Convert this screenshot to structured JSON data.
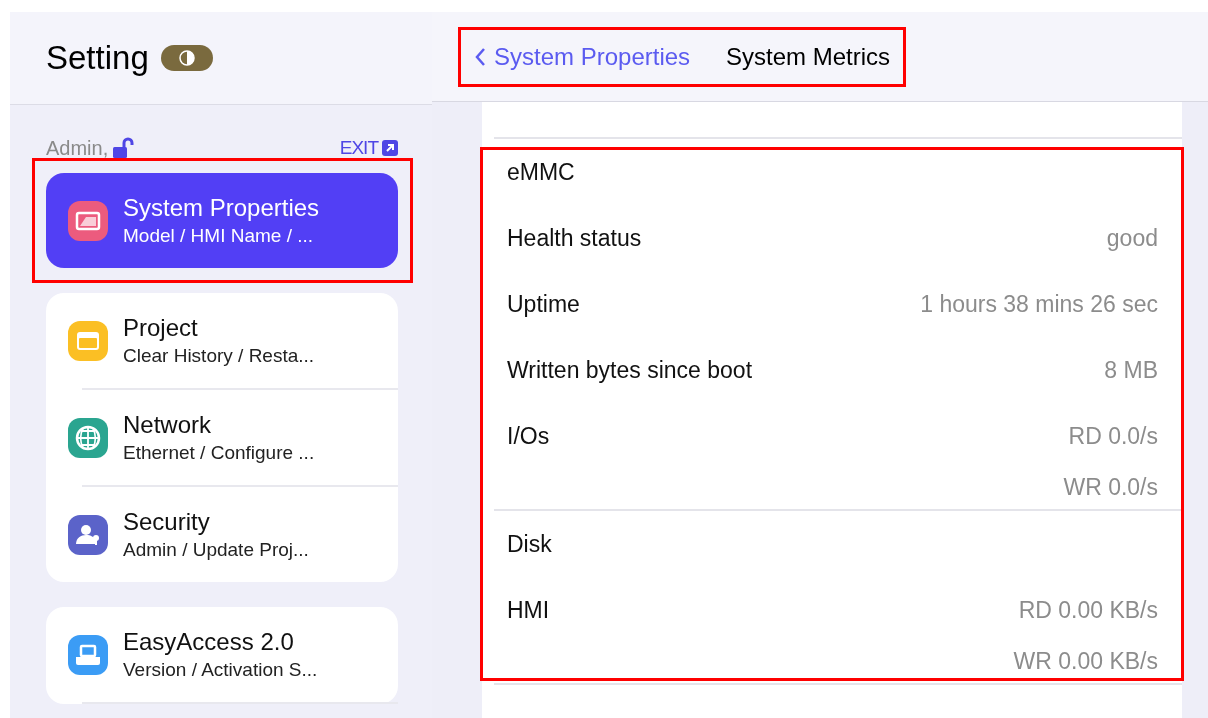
{
  "title": "Setting",
  "user": {
    "label": "Admin,",
    "locked": false
  },
  "exit": {
    "label": "EXIT"
  },
  "sidebar": {
    "groups": [
      {
        "items": [
          {
            "title": "System Properties",
            "subtitle": "Model / HMI Name / ...",
            "selected": true,
            "highlighted": true,
            "color": "#ec5b7e"
          }
        ]
      },
      {
        "items": [
          {
            "title": "Project",
            "subtitle": "Clear History / Resta...",
            "selected": false,
            "highlighted": false,
            "color": "#fbbf24"
          },
          {
            "title": "Network",
            "subtitle": "Ethernet / Configure ...",
            "selected": false,
            "highlighted": false,
            "color": "#2aa590"
          },
          {
            "title": "Security",
            "subtitle": "Admin / Update Proj...",
            "selected": false,
            "highlighted": false,
            "color": "#5b63c9"
          }
        ]
      },
      {
        "items": [
          {
            "title": "EasyAccess 2.0",
            "subtitle": "Version / Activation S...",
            "selected": false,
            "highlighted": false,
            "color": "#3b9cf5"
          }
        ]
      }
    ]
  },
  "breadcrumb": {
    "back": "System Properties",
    "current": "System Metrics",
    "highlighted": true
  },
  "blocks": [
    {
      "highlighted": true,
      "sections": [
        {
          "title": "eMMC",
          "rows": [
            {
              "label": "Health status",
              "values": [
                "good"
              ]
            },
            {
              "label": "Uptime",
              "values": [
                "1 hours 38 mins 26 sec"
              ]
            },
            {
              "label": "Written bytes since boot",
              "values": [
                "8 MB"
              ]
            },
            {
              "label": "I/Os",
              "values": [
                "RD 0.0/s",
                "WR 0.0/s"
              ]
            }
          ]
        },
        {
          "title": "Disk",
          "rows": [
            {
              "label": "HMI",
              "values": [
                "RD 0.00 KB/s",
                "WR 0.00 KB/s"
              ]
            }
          ]
        }
      ]
    }
  ]
}
